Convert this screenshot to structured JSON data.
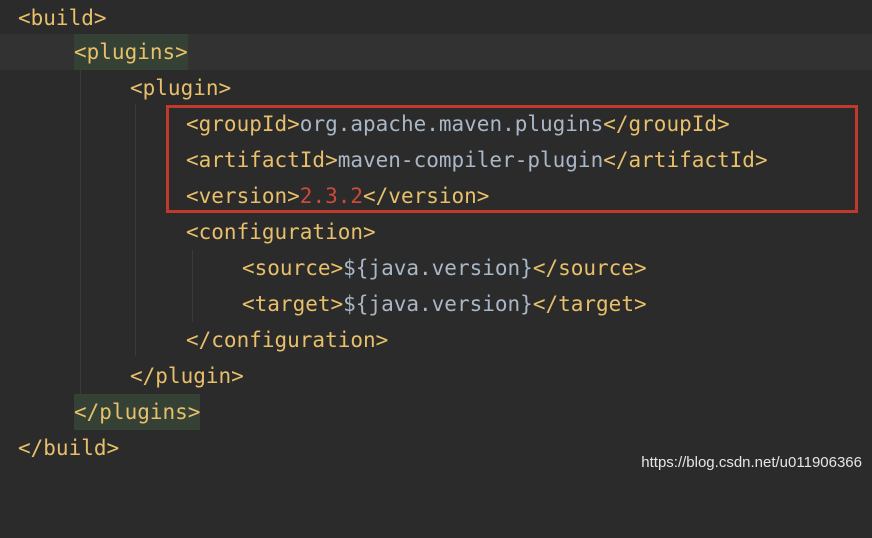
{
  "code": {
    "l1": {
      "tag": "<build>"
    },
    "l2": {
      "tag": "<plugins>"
    },
    "l3": {
      "tag": "<plugin>"
    },
    "l4": {
      "open": "<groupId>",
      "value": "org.apache.maven.plugins",
      "close": "</groupId>"
    },
    "l5": {
      "open": "<artifactId>",
      "value": "maven-compiler-plugin",
      "close": "</artifactId>"
    },
    "l6": {
      "open": "<version>",
      "value": "2.3.2",
      "close": "</version>"
    },
    "l7": {
      "tag": "<configuration>"
    },
    "l8": {
      "open": "<source>",
      "value": "${java.version}",
      "close": "</source>"
    },
    "l9": {
      "open": "<target>",
      "value": "${java.version}",
      "close": "</target>"
    },
    "l10": {
      "tag": "</configuration>"
    },
    "l11": {
      "tag": "</plugin>"
    },
    "l12": {
      "tag": "</plugins>"
    },
    "l13": {
      "tag": "</build>"
    }
  },
  "watermark": "https://blog.csdn.net/u011906366",
  "colors": {
    "background": "#2b2b2b",
    "tag": "#e8bf6a",
    "text": "#a9b7c6",
    "number": "#cc4a3c",
    "highlight_box": "#c0392b",
    "matched_tag_bg": "#344134"
  }
}
